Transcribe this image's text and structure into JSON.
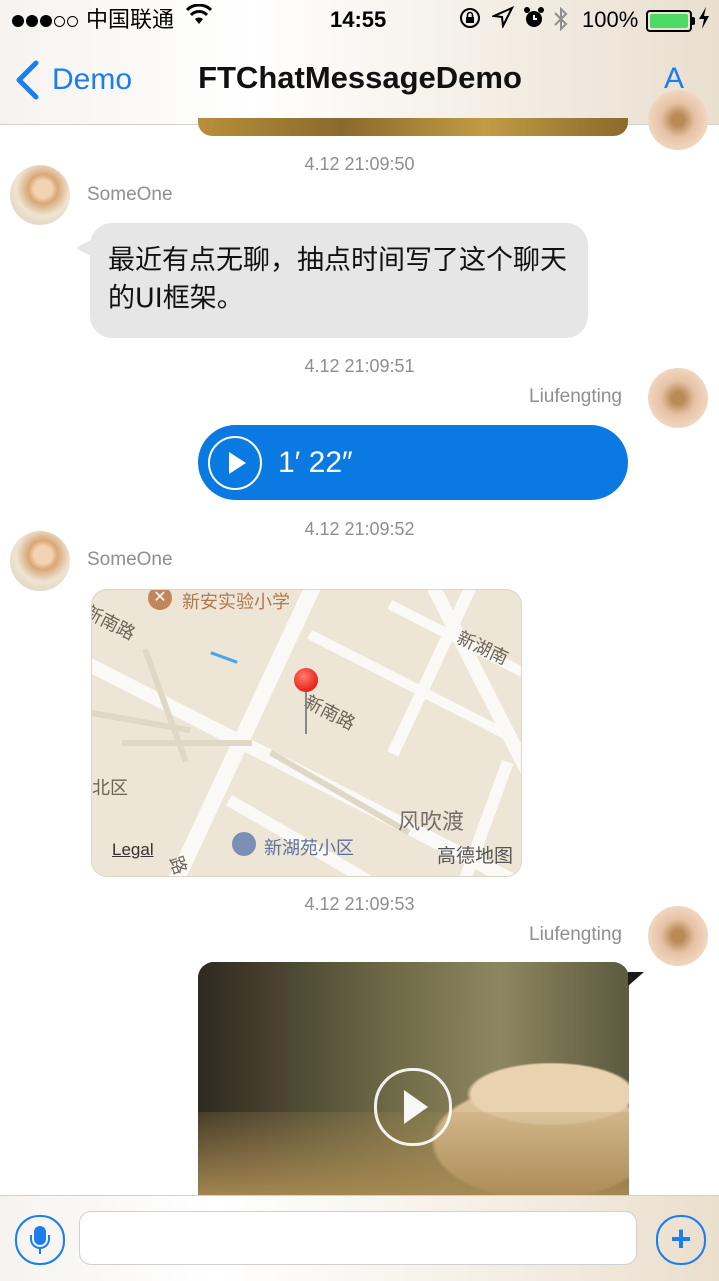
{
  "status_bar": {
    "carrier": "中国联通",
    "time": "14:55",
    "battery": "100%"
  },
  "nav": {
    "back_label": "Demo",
    "title": "FTChatMessageDemo",
    "right_label": "A"
  },
  "messages": [
    {
      "timestamp": "4.12 21:09:50",
      "sender": "SomeOne",
      "type": "text",
      "text": "最近有点无聊，抽点时间写了这个聊天的UI框架。"
    },
    {
      "timestamp": "4.12 21:09:51",
      "sender": "Liufengting",
      "type": "voice",
      "duration": "1′ 22″"
    },
    {
      "timestamp": "4.12 21:09:52",
      "sender": "SomeOne",
      "type": "location",
      "map_labels": {
        "school": "新安实验小学",
        "road1": "新南路",
        "road1b": "新南路",
        "road2": "新湖南",
        "district": "北区",
        "area": "风吹渡",
        "community": "新湖苑小区",
        "road3": "路",
        "legal": "Legal",
        "provider": "高德地图"
      }
    },
    {
      "timestamp": "4.12 21:09:53",
      "sender": "Liufengting",
      "type": "video"
    }
  ],
  "input": {
    "placeholder": ""
  },
  "colors": {
    "accent": "#1a7ef0",
    "outgoing_bubble": "#0a7ae2",
    "incoming_bubble": "#e6e6e6"
  }
}
